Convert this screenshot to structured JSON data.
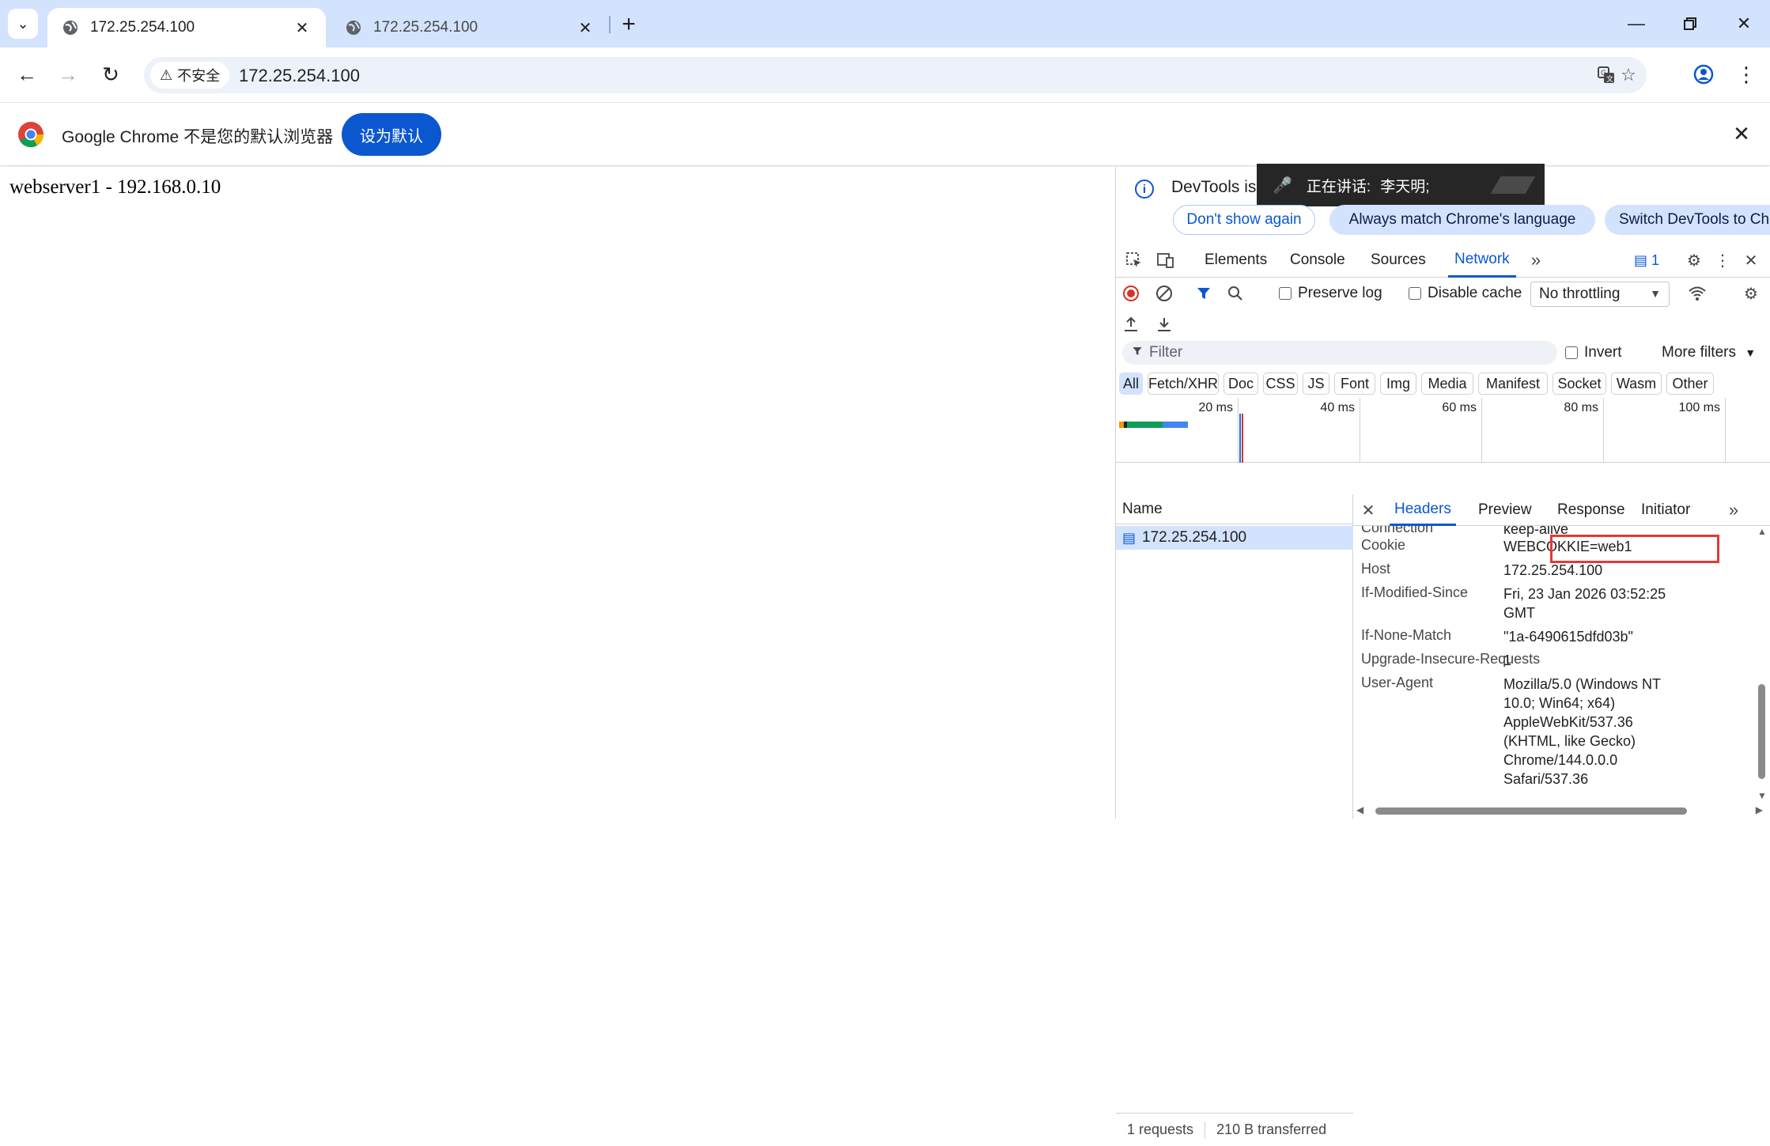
{
  "tabs": [
    {
      "title": "172.25.254.100"
    },
    {
      "title": "172.25.254.100"
    }
  ],
  "toolbar": {
    "security_label": "不安全",
    "url": "172.25.254.100"
  },
  "infobar": {
    "text": "Google Chrome 不是您的默认浏览器",
    "button": "设为默认"
  },
  "page": {
    "text": "webserver1 - 192.168.0.10"
  },
  "devtools": {
    "info_text": "DevTools is",
    "meeting": {
      "label": "正在讲话:",
      "speaker": "李天明;"
    },
    "pills": [
      "Don't show again",
      "Always match Chrome's language",
      "Switch DevTools to Chin"
    ],
    "tabs": [
      "Elements",
      "Console",
      "Sources",
      "Network"
    ],
    "issues_count": "1",
    "preserve_log": "Preserve log",
    "disable_cache": "Disable cache",
    "throttling": "No throttling",
    "filter_placeholder": "Filter",
    "invert": "Invert",
    "more_filters": "More filters",
    "types": [
      "All",
      "Fetch/XHR",
      "Doc",
      "CSS",
      "JS",
      "Font",
      "Img",
      "Media",
      "Manifest",
      "Socket",
      "Wasm",
      "Other"
    ],
    "timeline_labels": [
      "20 ms",
      "40 ms",
      "60 ms",
      "80 ms",
      "100 ms"
    ],
    "name_header": "Name",
    "request_name": "172.25.254.100",
    "status_requests": "1 requests",
    "status_transferred": "210 B transferred",
    "detail_tabs": [
      "Headers",
      "Preview",
      "Response",
      "Initiator"
    ],
    "headers": [
      {
        "name": "Connection",
        "value": "keep-alive"
      },
      {
        "name": "Cookie",
        "value": "WEBCOKKIE=web1"
      },
      {
        "name": "Host",
        "value": "172.25.254.100"
      },
      {
        "name": "If-Modified-Since",
        "value": "Fri, 23 Jan 2026 03:52:25 GMT"
      },
      {
        "name": "If-None-Match",
        "value": "\"1a-6490615dfd03b\""
      },
      {
        "name": "Upgrade-Insecure-Requests",
        "value": "1"
      },
      {
        "name": "User-Agent",
        "value": "Mozilla/5.0 (Windows NT 10.0; Win64; x64) AppleWebKit/537.36 (KHTML, like Gecko) Chrome/144.0.0.0 Safari/537.36"
      }
    ]
  },
  "colors": {
    "accent": "#0b57d0",
    "highlight_box": "#e53935",
    "titlebar": "#d3e3fd"
  }
}
